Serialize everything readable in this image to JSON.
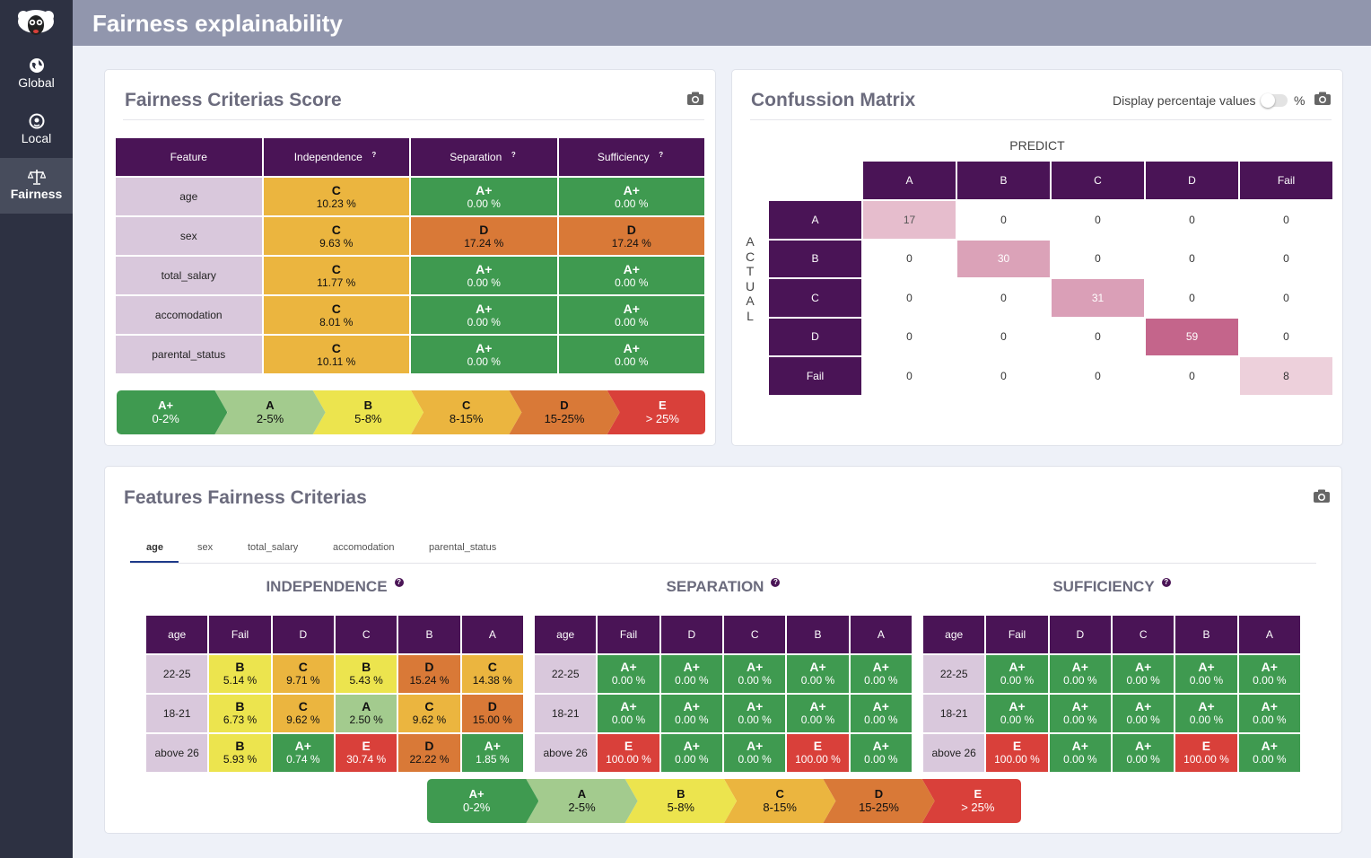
{
  "header": {
    "title": "Fairness explainability"
  },
  "nav": [
    {
      "label": "Global",
      "icon": "globe-icon"
    },
    {
      "label": "Local",
      "icon": "location-pin-icon"
    },
    {
      "label": "Fairness",
      "icon": "scale-balance-icon",
      "active": true
    }
  ],
  "colors": {
    "A+": "#3f9a50",
    "A": "#a3cb8e",
    "B": "#ece44e",
    "C": "#ebb53f",
    "D": "#d97937",
    "E": "#d9403a",
    "header": "#4a1456"
  },
  "score": {
    "title": "Fairness Criterias Score",
    "columns": [
      "Feature",
      "Independence",
      "Separation",
      "Sufficiency"
    ],
    "rows": [
      {
        "feature": "age",
        "cells": [
          {
            "g": "C",
            "p": "10.23 %"
          },
          {
            "g": "A+",
            "p": "0.00 %"
          },
          {
            "g": "A+",
            "p": "0.00 %"
          }
        ]
      },
      {
        "feature": "sex",
        "cells": [
          {
            "g": "C",
            "p": "9.63 %"
          },
          {
            "g": "D",
            "p": "17.24 %"
          },
          {
            "g": "D",
            "p": "17.24 %"
          }
        ]
      },
      {
        "feature": "total_salary",
        "cells": [
          {
            "g": "C",
            "p": "11.77 %"
          },
          {
            "g": "A+",
            "p": "0.00 %"
          },
          {
            "g": "A+",
            "p": "0.00 %"
          }
        ]
      },
      {
        "feature": "accomodation",
        "cells": [
          {
            "g": "C",
            "p": "8.01 %"
          },
          {
            "g": "A+",
            "p": "0.00 %"
          },
          {
            "g": "A+",
            "p": "0.00 %"
          }
        ]
      },
      {
        "feature": "parental_status",
        "cells": [
          {
            "g": "C",
            "p": "10.11 %"
          },
          {
            "g": "A+",
            "p": "0.00 %"
          },
          {
            "g": "A+",
            "p": "0.00 %"
          }
        ]
      }
    ]
  },
  "legend": [
    {
      "g": "A+",
      "r": "0-2%"
    },
    {
      "g": "A",
      "r": "2-5%"
    },
    {
      "g": "B",
      "r": "5-8%"
    },
    {
      "g": "C",
      "r": "8-15%"
    },
    {
      "g": "D",
      "r": "15-25%"
    },
    {
      "g": "E",
      "r": "> 25%"
    }
  ],
  "confusion": {
    "title": "Confussion Matrix",
    "toggle_label": "Display percentaje values",
    "toggle_suffix": "%",
    "predict_label": "PREDICT",
    "actual_label": "ACTUAL",
    "labels": [
      "A",
      "B",
      "C",
      "D",
      "Fail"
    ],
    "matrix": [
      [
        17,
        0,
        0,
        0,
        0
      ],
      [
        0,
        30,
        0,
        0,
        0
      ],
      [
        0,
        0,
        31,
        0,
        0
      ],
      [
        0,
        0,
        0,
        59,
        0
      ],
      [
        0,
        0,
        0,
        0,
        8
      ]
    ]
  },
  "features": {
    "title": "Features Fairness Criterias",
    "tabs": [
      "age",
      "sex",
      "total_salary",
      "accomodation",
      "parental_status"
    ],
    "active_tab": 0,
    "columns": [
      "age",
      "Fail",
      "D",
      "C",
      "B",
      "A"
    ],
    "row_labels": [
      "22-25",
      "18-21",
      "above 26"
    ],
    "sections": [
      {
        "name": "INDEPENDENCE",
        "rows": [
          [
            {
              "g": "B",
              "p": "5.14 %"
            },
            {
              "g": "C",
              "p": "9.71 %"
            },
            {
              "g": "B",
              "p": "5.43 %"
            },
            {
              "g": "D",
              "p": "15.24 %"
            },
            {
              "g": "C",
              "p": "14.38 %"
            }
          ],
          [
            {
              "g": "B",
              "p": "6.73 %"
            },
            {
              "g": "C",
              "p": "9.62 %"
            },
            {
              "g": "A",
              "p": "2.50 %"
            },
            {
              "g": "C",
              "p": "9.62 %"
            },
            {
              "g": "D",
              "p": "15.00 %"
            }
          ],
          [
            {
              "g": "B",
              "p": "5.93 %"
            },
            {
              "g": "A+",
              "p": "0.74 %"
            },
            {
              "g": "E",
              "p": "30.74 %"
            },
            {
              "g": "D",
              "p": "22.22 %"
            },
            {
              "g": "A+",
              "p": "1.85 %"
            }
          ]
        ]
      },
      {
        "name": "SEPARATION",
        "rows": [
          [
            {
              "g": "A+",
              "p": "0.00 %"
            },
            {
              "g": "A+",
              "p": "0.00 %"
            },
            {
              "g": "A+",
              "p": "0.00 %"
            },
            {
              "g": "A+",
              "p": "0.00 %"
            },
            {
              "g": "A+",
              "p": "0.00 %"
            }
          ],
          [
            {
              "g": "A+",
              "p": "0.00 %"
            },
            {
              "g": "A+",
              "p": "0.00 %"
            },
            {
              "g": "A+",
              "p": "0.00 %"
            },
            {
              "g": "A+",
              "p": "0.00 %"
            },
            {
              "g": "A+",
              "p": "0.00 %"
            }
          ],
          [
            {
              "g": "E",
              "p": "100.00 %"
            },
            {
              "g": "A+",
              "p": "0.00 %"
            },
            {
              "g": "A+",
              "p": "0.00 %"
            },
            {
              "g": "E",
              "p": "100.00 %"
            },
            {
              "g": "A+",
              "p": "0.00 %"
            }
          ]
        ]
      },
      {
        "name": "SUFFICIENCY",
        "rows": [
          [
            {
              "g": "A+",
              "p": "0.00 %"
            },
            {
              "g": "A+",
              "p": "0.00 %"
            },
            {
              "g": "A+",
              "p": "0.00 %"
            },
            {
              "g": "A+",
              "p": "0.00 %"
            },
            {
              "g": "A+",
              "p": "0.00 %"
            }
          ],
          [
            {
              "g": "A+",
              "p": "0.00 %"
            },
            {
              "g": "A+",
              "p": "0.00 %"
            },
            {
              "g": "A+",
              "p": "0.00 %"
            },
            {
              "g": "A+",
              "p": "0.00 %"
            },
            {
              "g": "A+",
              "p": "0.00 %"
            }
          ],
          [
            {
              "g": "E",
              "p": "100.00 %"
            },
            {
              "g": "A+",
              "p": "0.00 %"
            },
            {
              "g": "A+",
              "p": "0.00 %"
            },
            {
              "g": "E",
              "p": "100.00 %"
            },
            {
              "g": "A+",
              "p": "0.00 %"
            }
          ]
        ]
      }
    ]
  }
}
